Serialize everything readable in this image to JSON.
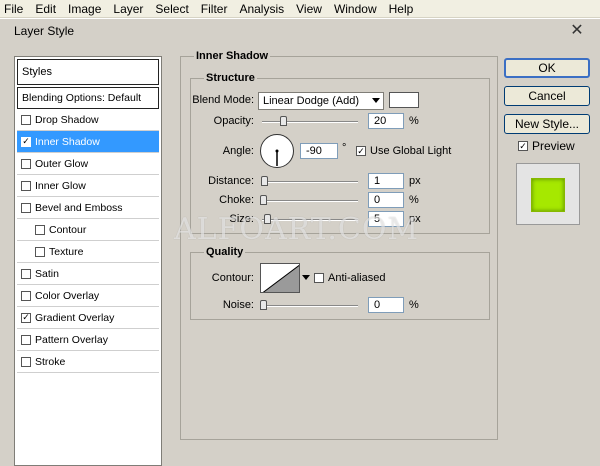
{
  "menu": [
    "File",
    "Edit",
    "Image",
    "Layer",
    "Select",
    "Filter",
    "Analysis",
    "View",
    "Window",
    "Help"
  ],
  "dialog": {
    "title": "Layer Style"
  },
  "styles_list": {
    "header": "Styles",
    "blending": "Blending Options: Default",
    "items": [
      {
        "label": "Drop Shadow",
        "checked": false,
        "selected": false,
        "sub": false
      },
      {
        "label": "Inner Shadow",
        "checked": true,
        "selected": true,
        "sub": false
      },
      {
        "label": "Outer Glow",
        "checked": false,
        "selected": false,
        "sub": false
      },
      {
        "label": "Inner Glow",
        "checked": false,
        "selected": false,
        "sub": false
      },
      {
        "label": "Bevel and Emboss",
        "checked": false,
        "selected": false,
        "sub": false
      },
      {
        "label": "Contour",
        "checked": false,
        "selected": false,
        "sub": true
      },
      {
        "label": "Texture",
        "checked": false,
        "selected": false,
        "sub": true
      },
      {
        "label": "Satin",
        "checked": false,
        "selected": false,
        "sub": false
      },
      {
        "label": "Color Overlay",
        "checked": false,
        "selected": false,
        "sub": false
      },
      {
        "label": "Gradient Overlay",
        "checked": true,
        "selected": false,
        "sub": false
      },
      {
        "label": "Pattern Overlay",
        "checked": false,
        "selected": false,
        "sub": false
      },
      {
        "label": "Stroke",
        "checked": false,
        "selected": false,
        "sub": false
      }
    ]
  },
  "panel": {
    "title": "Inner Shadow",
    "structure": {
      "title": "Structure",
      "blend_mode_label": "Blend Mode:",
      "blend_mode_value": "Linear Dodge (Add)",
      "opacity_label": "Opacity:",
      "opacity_value": "20",
      "angle_label": "Angle:",
      "angle_value": "-90",
      "degree_symbol": "°",
      "use_global_light_label": "Use Global Light",
      "distance_label": "Distance:",
      "distance_value": "1",
      "choke_label": "Choke:",
      "choke_value": "0",
      "size_label": "Size:",
      "size_value": "5",
      "percent": "%",
      "px": "px"
    },
    "quality": {
      "title": "Quality",
      "contour_label": "Contour:",
      "anti_aliased_label": "Anti-aliased",
      "noise_label": "Noise:",
      "noise_value": "0",
      "percent": "%"
    }
  },
  "buttons": {
    "ok": "OK",
    "cancel": "Cancel",
    "new_style": "New Style...",
    "preview_label": "Preview"
  },
  "watermark": "ALFOART.COM",
  "colors": {
    "selection": "#3399ff",
    "preview_fill": "#a6e800",
    "dialog_bg": "#d4d0c8"
  }
}
